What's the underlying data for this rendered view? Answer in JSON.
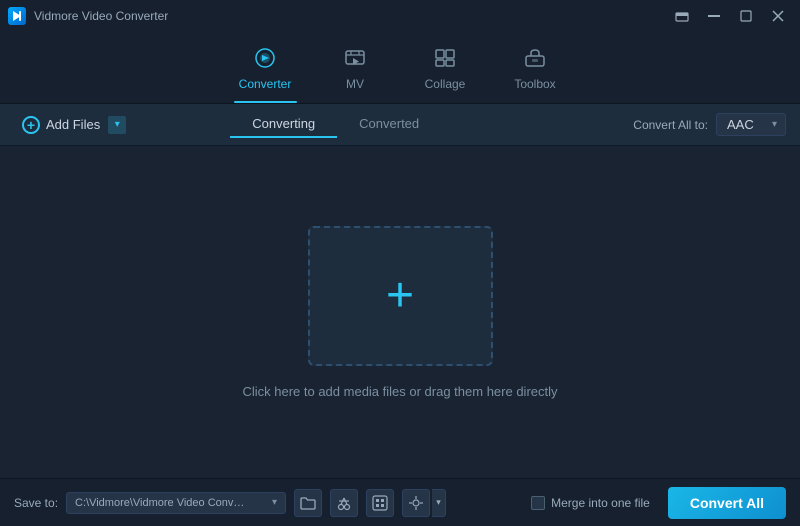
{
  "app": {
    "title": "Vidmore Video Converter",
    "icon_label": "V"
  },
  "window_controls": {
    "caption_btn": "⬜",
    "minimize_label": "–",
    "maximize_label": "☐",
    "close_label": "✕",
    "caption_icon": "▣"
  },
  "nav": {
    "tabs": [
      {
        "id": "converter",
        "label": "Converter",
        "active": true
      },
      {
        "id": "mv",
        "label": "MV",
        "active": false
      },
      {
        "id": "collage",
        "label": "Collage",
        "active": false
      },
      {
        "id": "toolbox",
        "label": "Toolbox",
        "active": false
      }
    ]
  },
  "toolbar": {
    "add_files_label": "Add Files",
    "converting_tab": "Converting",
    "converted_tab": "Converted",
    "convert_all_to_label": "Convert All to:",
    "format_selected": "AAC"
  },
  "main": {
    "drop_zone_hint": "Click here to add media files or drag them here directly",
    "plus_symbol": "+"
  },
  "bottom_bar": {
    "save_to_label": "Save to:",
    "save_path": "C:\\Vidmore\\Vidmore Video Converter\\Converted",
    "merge_label": "Merge into one file",
    "convert_all_label": "Convert All"
  }
}
